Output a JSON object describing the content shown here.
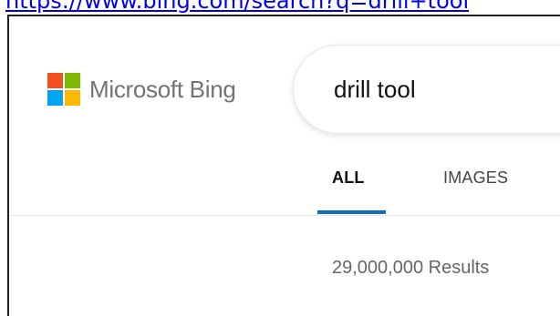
{
  "address_bar": {
    "url_text": "https://www.bing.com/search?q=drill+tool"
  },
  "logo": {
    "text": "Microsoft Bing",
    "colors": [
      "#f25022",
      "#7fba00",
      "#00a4ef",
      "#ffb900"
    ]
  },
  "search": {
    "query": "drill tool"
  },
  "tabs": [
    {
      "label": "ALL",
      "active": true
    },
    {
      "label": "IMAGES",
      "active": false
    }
  ],
  "results": {
    "count_text": "29,000,000 Results"
  },
  "colors": {
    "accent": "#0c6dc2"
  }
}
